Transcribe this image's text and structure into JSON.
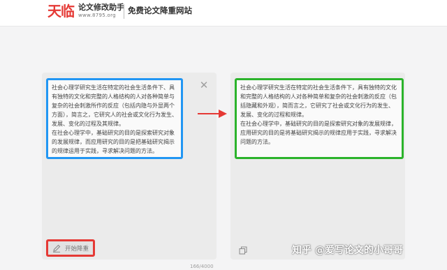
{
  "header": {
    "logo_mark": "天临",
    "logo_name": "论文修改助手",
    "logo_url": "www.8795.org",
    "slogan": "免费论文降重网站"
  },
  "input_panel": {
    "paragraphs": [
      "社会心理学研究生活在特定的社会生活条件下、具有独特的文化和完整的人格结构的人对各种简单与复杂的社会刺激所作的反应（包括内隐与外显两个方面），简言之，它研究人的社会或文化行为发生、发展、变化的过程及其规律。",
      "在社会心理学中，基础研究的目的是探索研究对象的发展规律，而应用研究的目的是把基础研究揭示的规律运用于实践，寻求解决问题的方法。"
    ],
    "start_button_label": "开始降重",
    "char_counter": "166/4000"
  },
  "output_panel": {
    "paragraphs": [
      "社会心理学研究生活在特定的社会生活条件下，具有独特的文化和完整的人格结构的人对各种简单和复杂的社会刺激的反应（包括隐藏和外观），简而言之，它研究了社会或文化行为的发生、发展、变化的过程和规律。",
      "在社会心理学中，基础研究的目的是探索研究对象的发展规律，应用研究的目的是将基础研究揭示的规律应用于实践，寻求解决问题的方法。"
    ]
  },
  "watermark": "知乎 @爱写论文的小哥哥",
  "icons": {
    "close": "close-icon",
    "arrow": "arrow-right-icon",
    "pen": "pen-icon",
    "copy": "copy-icon"
  },
  "colors": {
    "brand_red": "#e53935",
    "input_border": "#2196f3",
    "output_border": "#2bb32b",
    "annotation_red": "#e53935"
  }
}
